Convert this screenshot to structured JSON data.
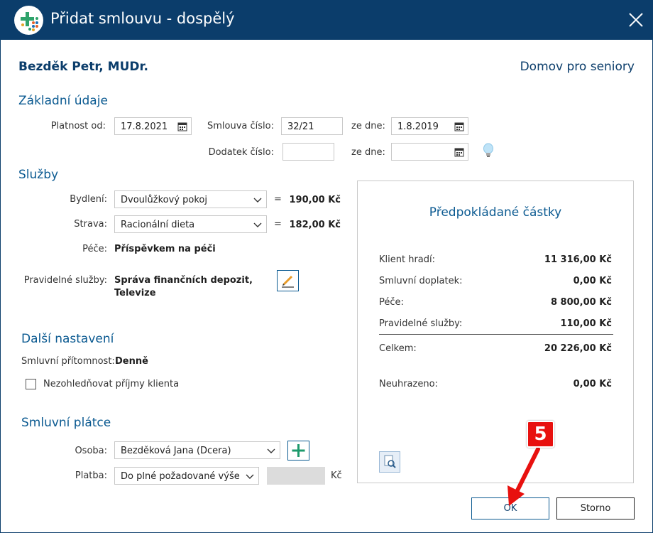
{
  "window": {
    "title": "Přidat smlouvu - dospělý"
  },
  "header": {
    "client_name": "Bezděk Petr, MUDr.",
    "facility": "Domov pro seniory"
  },
  "basic": {
    "section_title": "Základní údaje",
    "valid_from_label": "Platnost od:",
    "valid_from_value": "17.8.2021",
    "contract_no_label": "Smlouva číslo:",
    "contract_no_value": "32/21",
    "contract_date_label": "ze dne:",
    "contract_date_value": "1.8.2019",
    "amendment_no_label": "Dodatek číslo:",
    "amendment_no_value": "",
    "amendment_date_label": "ze dne:",
    "amendment_date_value": ""
  },
  "services": {
    "section_title": "Služby",
    "housing_label": "Bydlení:",
    "housing_value": "Dvoulůžkový pokoj",
    "housing_price": "190,00 Kč",
    "food_label": "Strava:",
    "food_value": "Racionální dieta",
    "food_price": "182,00 Kč",
    "care_label": "Péče:",
    "care_value": "Příspěvkem na péči",
    "regular_label": "Pravidelné služby:",
    "regular_value_line1": "Správa finančních depozit,",
    "regular_value_line2": "Televize",
    "equals": "="
  },
  "other": {
    "section_title": "Další nastavení",
    "presence_label": "Smluvní přítomnost:",
    "presence_value": "Denně",
    "ignore_income_label": "Nezohledňovat příjmy klienta",
    "ignore_income_checked": false
  },
  "payer": {
    "section_title": "Smluvní plátce",
    "person_label": "Osoba:",
    "person_value": "Bezděková Jana (Dcera)",
    "payment_label": "Platba:",
    "payment_value": "Do plné požadované výše",
    "currency": "Kč"
  },
  "summary": {
    "title": "Předpokládané částky",
    "rows": [
      {
        "label": "Klient hradí:",
        "value": "11 316,00 Kč"
      },
      {
        "label": "Smluvní doplatek:",
        "value": "0,00 Kč"
      },
      {
        "label": "Péče:",
        "value": "8 800,00 Kč"
      },
      {
        "label": "Pravidelné služby:",
        "value": "110,00 Kč"
      }
    ],
    "total_label": "Celkem:",
    "total_value": "20 226,00 Kč",
    "unpaid_label": "Neuhrazeno:",
    "unpaid_value": "0,00 Kč"
  },
  "buttons": {
    "ok": "OK",
    "cancel": "Storno"
  },
  "annotation": {
    "step": "5"
  },
  "colors": {
    "titlebar": "#0b3d6b",
    "accent": "#0b5a91",
    "annotation_red": "#e8110f"
  },
  "icons": [
    "app-logo-icon",
    "close-icon",
    "calendar-icon",
    "lightbulb-icon",
    "chevron-down-icon",
    "pencil-icon",
    "plus-icon",
    "preview-icon"
  ]
}
